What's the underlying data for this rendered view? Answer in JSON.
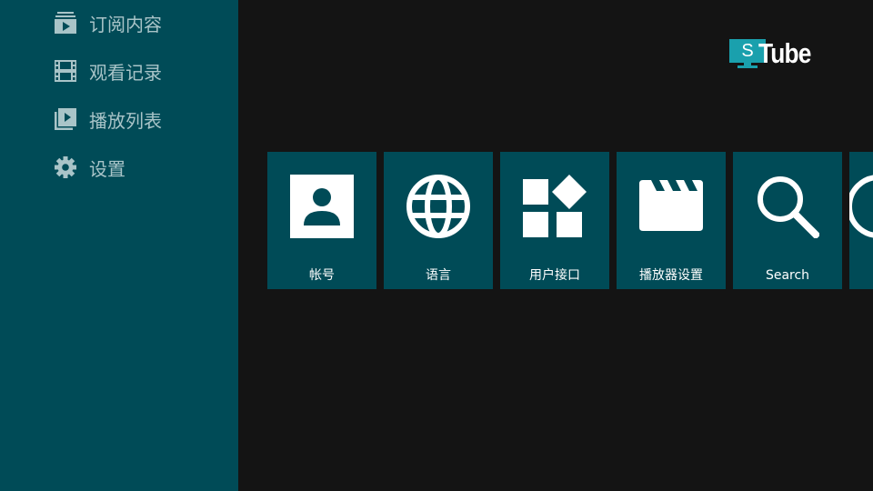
{
  "sidebar": {
    "items": [
      {
        "label": "订阅内容",
        "icon": "subscriptions-icon"
      },
      {
        "label": "观看记录",
        "icon": "history-film-icon"
      },
      {
        "label": "播放列表",
        "icon": "playlist-icon"
      },
      {
        "label": "设置",
        "icon": "gear-icon"
      }
    ]
  },
  "logo": {
    "badge_letter": "S",
    "word": "Tube"
  },
  "cards": [
    {
      "label": "帐号",
      "icon": "account-icon"
    },
    {
      "label": "语言",
      "icon": "globe-icon"
    },
    {
      "label": "用户接口",
      "icon": "widgets-icon"
    },
    {
      "label": "播放器设置",
      "icon": "clapperboard-icon"
    },
    {
      "label": "Search",
      "icon": "search-icon"
    },
    {
      "label": "",
      "icon": "partial-card-icon"
    }
  ],
  "colors": {
    "sidebar_bg": "#004b57",
    "main_bg": "#141414",
    "card_bg": "#004b57",
    "nav_text": "#a9c4c8",
    "logo_badge": "#1aa0ad"
  }
}
